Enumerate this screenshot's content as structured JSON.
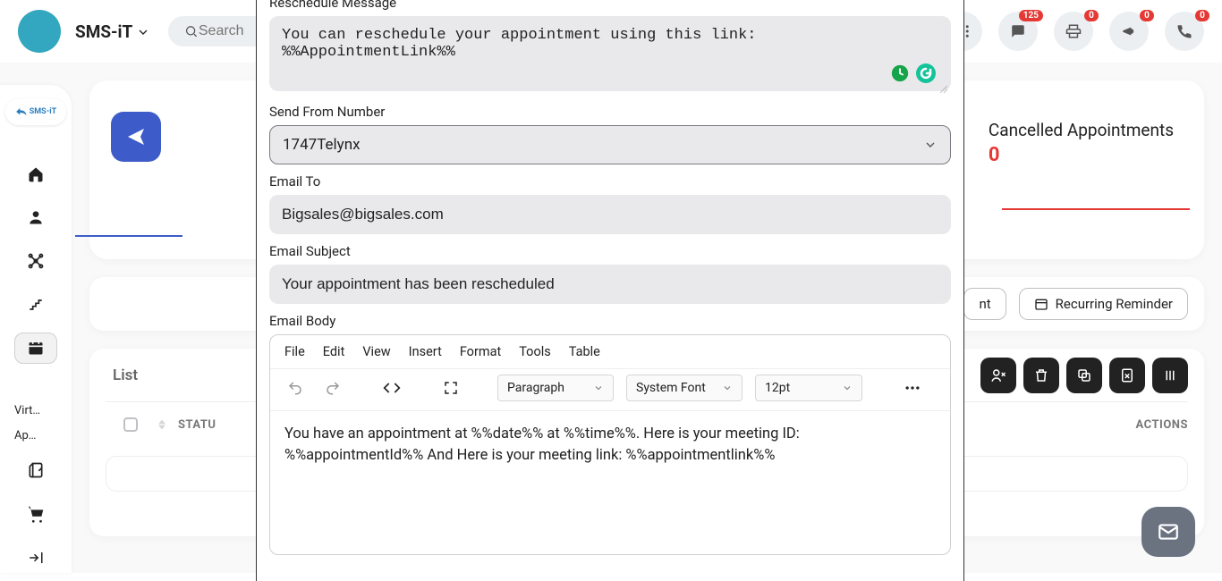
{
  "brand": "SMS-iT",
  "search_placeholder": "Search",
  "top_badges": {
    "chat": "125",
    "print": "0",
    "announce": "0",
    "phone": "0"
  },
  "leftrail": {
    "logo": "SMS-iT",
    "text_items": [
      "Virt…",
      "Ap…"
    ]
  },
  "cancelled": {
    "title": "Cancelled Appointments",
    "count": "0"
  },
  "pill2_label_partial": "nt",
  "recurring_label": "Recurring Reminder",
  "tabs": {
    "list": "List"
  },
  "table": {
    "status_col": "STATU",
    "actions_col": "ACTIONS"
  },
  "modal": {
    "reschedule_label": "Reschedule Message",
    "reschedule_value": "You can reschedule your appointment using this link: %%AppointmentLink%%",
    "send_from_label": "Send From Number",
    "send_from_value": "1747Telynx",
    "email_to_label": "Email To",
    "email_to_value": "Bigsales@bigsales.com",
    "email_subject_label": "Email Subject",
    "email_subject_value": "Your appointment has been rescheduled",
    "email_body_label": "Email Body",
    "editor": {
      "menus": [
        "File",
        "Edit",
        "View",
        "Insert",
        "Format",
        "Tools",
        "Table"
      ],
      "paragraph": "Paragraph",
      "font": "System Font",
      "size": "12pt",
      "body": "You have an appointment at %%date%% at %%time%%. Here is your meeting ID: %%appointmentId%% And Here is your meeting link: %%appointmentlink%%"
    }
  }
}
